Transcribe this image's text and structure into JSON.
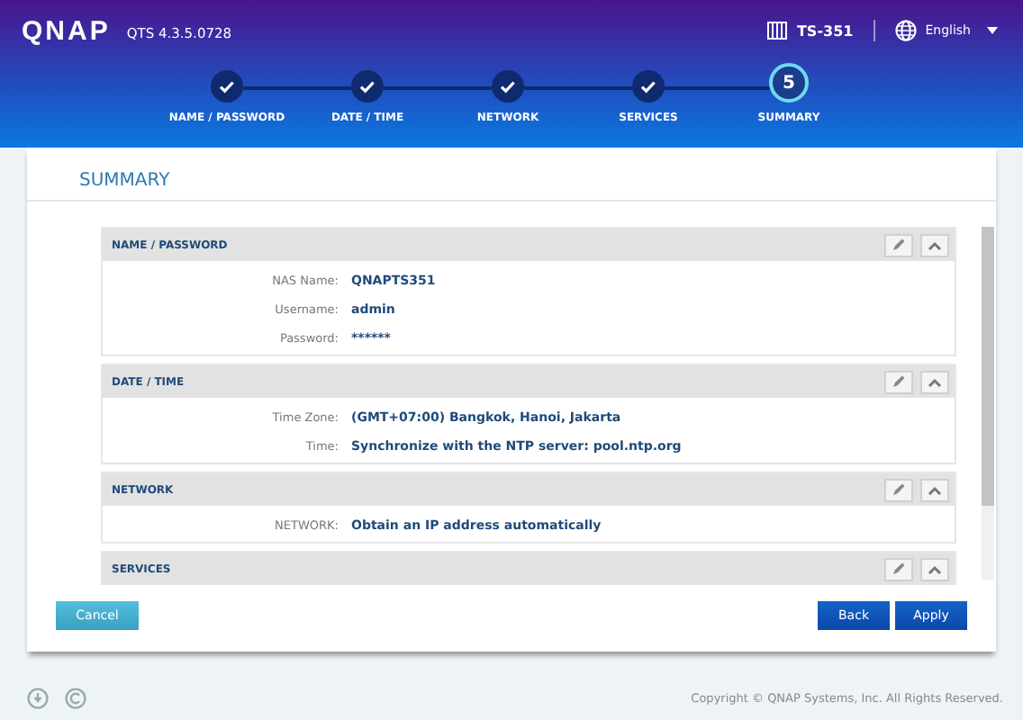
{
  "header": {
    "logo": "QNAP",
    "version": "QTS 4.3.5.0728",
    "device": "TS-351",
    "language": "English"
  },
  "steps": [
    {
      "label": "NAME / PASSWORD",
      "completed": true
    },
    {
      "label": "DATE / TIME",
      "completed": true
    },
    {
      "label": "NETWORK",
      "completed": true
    },
    {
      "label": "SERVICES",
      "completed": true
    },
    {
      "label": "SUMMARY",
      "completed": false,
      "number": "5"
    }
  ],
  "title": "SUMMARY",
  "sections": [
    {
      "title": "NAME / PASSWORD",
      "fields": [
        {
          "label": "NAS Name:",
          "value": "QNAPTS351"
        },
        {
          "label": "Username:",
          "value": "admin"
        },
        {
          "label": "Password:",
          "value": "******"
        }
      ]
    },
    {
      "title": "DATE / TIME",
      "fields": [
        {
          "label": "Time Zone:",
          "value": "(GMT+07:00) Bangkok, Hanoi, Jakarta"
        },
        {
          "label": "Time:",
          "value": "Synchronize with the NTP server: pool.ntp.org"
        }
      ]
    },
    {
      "title": "NETWORK",
      "fields": [
        {
          "label": "NETWORK:",
          "value": "Obtain an IP address automatically"
        }
      ]
    },
    {
      "title": "SERVICES"
    }
  ],
  "buttons": {
    "cancel": "Cancel",
    "back": "Back",
    "apply": "Apply"
  },
  "copyright": "Copyright © QNAP Systems, Inc. All Rights Reserved."
}
